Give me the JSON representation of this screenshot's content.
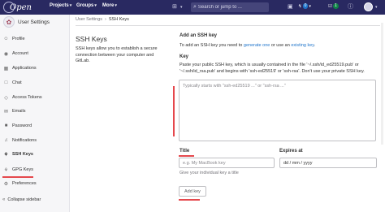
{
  "topbar": {
    "logo_text": "Open",
    "nav": {
      "projects": "Projects",
      "groups": "Groups",
      "more": "More"
    },
    "search_placeholder": "Search or jump to ...",
    "counts": {
      "merge_requests": "0",
      "todos": "1"
    }
  },
  "sidebar": {
    "title": "User Settings",
    "items": [
      {
        "label": "Profile",
        "icon": "profile-icon"
      },
      {
        "label": "Account",
        "icon": "account-icon"
      },
      {
        "label": "Applications",
        "icon": "applications-icon"
      },
      {
        "label": "Chat",
        "icon": "chat-icon"
      },
      {
        "label": "Access Tokens",
        "icon": "token-icon"
      },
      {
        "label": "Emails",
        "icon": "mail-icon"
      },
      {
        "label": "Password",
        "icon": "lock-icon"
      },
      {
        "label": "Notifications",
        "icon": "bell-icon"
      },
      {
        "label": "SSH Keys",
        "icon": "key-icon",
        "active": true
      },
      {
        "label": "GPG Keys",
        "icon": "key-icon"
      },
      {
        "label": "Preferences",
        "icon": "preferences-icon"
      }
    ],
    "collapse": "Collapse sidebar"
  },
  "breadcrumb": {
    "parent": "User Settings",
    "current": "SSH Keys"
  },
  "left": {
    "title": "SSH Keys",
    "description": "SSH keys allow you to establish a secure connection between your computer and GitLab."
  },
  "form": {
    "heading": "Add an SSH key",
    "intro_prefix": "To add an SSH key you need to",
    "intro_link1": "generate one",
    "intro_middle": "or use an",
    "intro_link2": "existing key",
    "intro_suffix": ".",
    "key_label": "Key",
    "key_help": "Paste your public SSH key, which is usually contained in the file '~/.ssh/id_ed25519.pub' or '~/.ssh/id_rsa.pub' and begins with 'ssh-ed25519' or 'ssh-rsa'. Don't use your private SSH key.",
    "key_placeholder": "Typically starts with \"ssh-ed25519 ...\" or \"ssh-rsa ...\"",
    "title_label": "Title",
    "title_placeholder": "e.g. My MacBook key",
    "title_help": "Give your individual key a title",
    "expires_label": "Expires at",
    "expires_value": "dd / mm / yyyy",
    "add_button": "Add key"
  },
  "colors": {
    "navbar": "#292961",
    "annotation_red": "#e5484d",
    "link": "#1f75cb"
  }
}
